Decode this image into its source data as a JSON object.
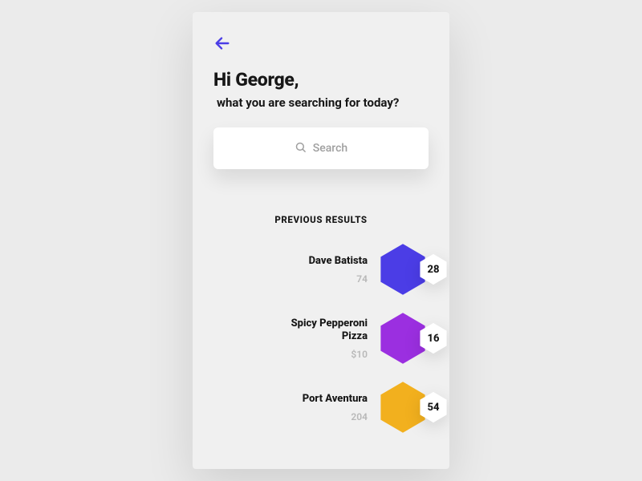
{
  "header": {
    "greeting": "Hi George,",
    "subtitle": "what you are searching for today?"
  },
  "search": {
    "placeholder": "Search"
  },
  "section": {
    "title": "PREVIOUS RESULTS"
  },
  "colors": {
    "accent": "#4b3de6"
  },
  "results": [
    {
      "name": "Dave Batista",
      "meta": "74",
      "color": "#4b3de6",
      "count": "28"
    },
    {
      "name": "Spicy Pepperoni Pizza",
      "meta": "$10",
      "color": "#9b2fe0",
      "count": "16"
    },
    {
      "name": "Port Aventura",
      "meta": "204",
      "color": "#f2b01e",
      "count": "54"
    }
  ]
}
